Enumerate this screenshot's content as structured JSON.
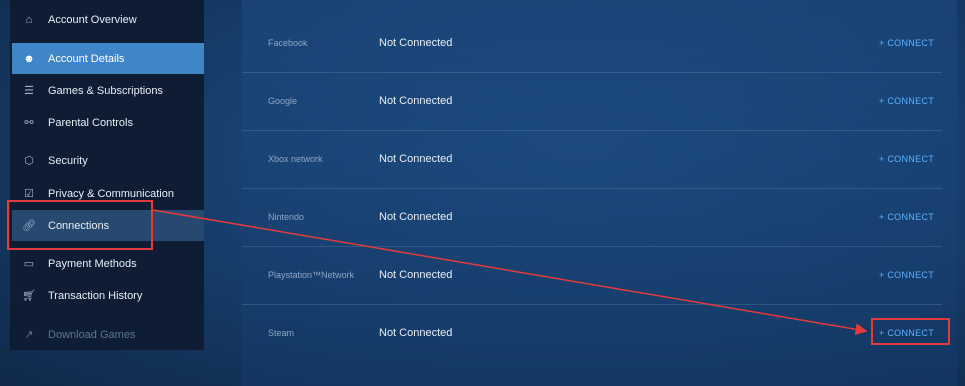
{
  "sidebar": {
    "items": [
      {
        "label": "Account Overview",
        "icon": "home-icon"
      },
      {
        "label": "Account Details",
        "icon": "user-icon"
      },
      {
        "label": "Games & Subscriptions",
        "icon": "list-icon"
      },
      {
        "label": "Parental Controls",
        "icon": "family-icon"
      },
      {
        "label": "Security",
        "icon": "shield-icon"
      },
      {
        "label": "Privacy & Communication",
        "icon": "lock-icon"
      },
      {
        "label": "Connections",
        "icon": "link-icon"
      },
      {
        "label": "Payment Methods",
        "icon": "card-icon"
      },
      {
        "label": "Transaction History",
        "icon": "cart-icon"
      },
      {
        "label": "Download Games",
        "icon": "external-link-icon"
      }
    ]
  },
  "connections": {
    "rows": [
      {
        "service": "Facebook",
        "status": "Not Connected",
        "action": "+ CONNECT"
      },
      {
        "service": "Google",
        "status": "Not Connected",
        "action": "+ CONNECT"
      },
      {
        "service": "Xbox network",
        "status": "Not Connected",
        "action": "+ CONNECT"
      },
      {
        "service": "Nintendo",
        "status": "Not Connected",
        "action": "+ CONNECT"
      },
      {
        "service": "Playstation™Network",
        "status": "Not Connected",
        "action": "+ CONNECT"
      },
      {
        "service": "Steam",
        "status": "Not Connected",
        "action": "+ CONNECT"
      }
    ]
  },
  "colors": {
    "accent": "#3f86c9",
    "link": "#5cb0ff",
    "highlight": "#e33b3b"
  }
}
